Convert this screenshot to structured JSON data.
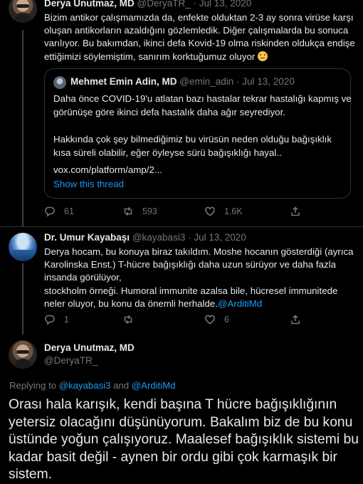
{
  "tweet1": {
    "author_name": "Derya Unutmaz, MD",
    "meta": "@DeryaTR_ · Jul 13, 2020",
    "lines": [
      "Bizim antikor çalışmamızda da, enfekte olduktan 2-3 ay sonra virüse karşı",
      "oluşan antikorların azaldığını gözlemledik. Diğer çalışmalarda bu sonuca",
      "varılıyor. Bu bakımdan, ikinci defa Kovid-19 olma riskinden oldukça endişe",
      "ettiğimizi söylemiştim, sanırım korktuğumuz oluyor"
    ],
    "emoji": "worried-face-emoji",
    "quote": {
      "author_name": "Mehmet Emin Adin, MD",
      "meta": "@emin_adin · Jul 13, 2020",
      "lines1": [
        "Daha önce COVID-19'u atlatan bazı hastalar tekrar hastalığı kapmış ve",
        "görünüşe göre ikinci defa hastalık daha ağır seyrediyor."
      ],
      "lines2": [
        "Hakkında çok şey bilmediğimiz bu virüsün neden olduğu bağışıklık",
        "kısa süreli olabilir, eğer öyleyse sürü bağışıklığı hayal.."
      ],
      "url": "vox.com/platform/amp/2...",
      "show_thread": "Show this thread"
    },
    "actions": {
      "replies": "61",
      "retweets": "593",
      "likes": "1.6K"
    }
  },
  "tweet2": {
    "author_name": "Dr. Umur Kayabaşı",
    "meta": "@kayabasi3 · Jul 13, 2020",
    "lines": [
      "Derya hocam, bu konuya biraz takıldım. Moshe hocanın gösterdiği (ayrıca",
      "Karolinska Enst.) T-hücre bağışıklığı daha uzun sürüyor ve daha fazla",
      "insanda görülüyor,",
      "stockholm örneği. Humoral immunite azalsa bile, hücresel immunitede"
    ],
    "last_line": "neler oluyor, bu konu da önemli herhalde.",
    "mention": "@ArditiMd",
    "actions": {
      "replies": "1",
      "likes": "6"
    }
  },
  "tweet3": {
    "author_name": "Derya Unutmaz, MD",
    "handle": "@DeryaTR_",
    "replying_prefix": "Replying to",
    "replying_mention1": "@kayabasi3",
    "replying_and": "and",
    "replying_mention2": "@ArditiMd",
    "lines": [
      "Orası hala karışık, kendi başına T hücre bağışıklığının",
      "yetersiz olacağını düşünüyorum. Bakalım biz de bu konu",
      "üstünde yoğun çalışıyoruz. Maalesef bağışıklık sistemi bu",
      "kadar basit değil - aynen bir ordu gibi çok karmaşık bir",
      "sistem."
    ]
  },
  "colors": {
    "background": "#000000",
    "text": "#e7e9ea",
    "muted": "#71767b",
    "link": "#1d9bf0",
    "border": "#2f3336"
  }
}
